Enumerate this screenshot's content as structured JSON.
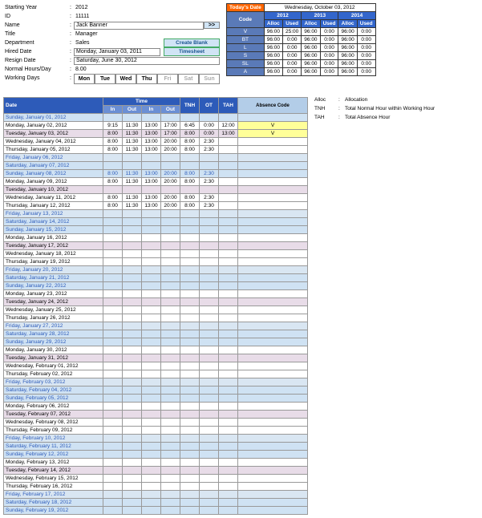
{
  "form": {
    "labels": {
      "year": "Starting Year",
      "id": "ID",
      "name": "Name",
      "title": "Title",
      "dept": "Department",
      "hired": "Hired Date",
      "resign": "Resign Date",
      "hours": "Normal Hours/Day",
      "days": "Working Days"
    },
    "values": {
      "year": "2012",
      "id": "11111",
      "name": "Jack Banner",
      "title": "Manager",
      "dept": "Sales",
      "hired": "Monday, January 03, 2011",
      "resign": "Saturday, June 30, 2012",
      "hours": "8.00"
    },
    "nav": ">>",
    "actions": {
      "blank": "Create Blank",
      "ts": "Timesheet"
    },
    "days": [
      "Mon",
      "Tue",
      "Wed",
      "Thu",
      "Fri",
      "Sat",
      "Sun"
    ]
  },
  "alloc": {
    "todayLabel": "Today's Date",
    "todayValue": "Wednesday, October 03, 2012",
    "codeHdr": "Code",
    "years": [
      "2012",
      "2013",
      "2014"
    ],
    "sub": [
      "Alloc",
      "Used"
    ],
    "rows": [
      {
        "c": "V",
        "v": [
          "96:00",
          "25:00",
          "96:00",
          "0:00",
          "96:00",
          "0:00"
        ]
      },
      {
        "c": "BT",
        "v": [
          "96:00",
          "0:00",
          "96:00",
          "0:00",
          "96:00",
          "0:00"
        ]
      },
      {
        "c": "L",
        "v": [
          "96:00",
          "0:00",
          "96:00",
          "0:00",
          "96:00",
          "0:00"
        ]
      },
      {
        "c": "S",
        "v": [
          "96:00",
          "0:00",
          "96:00",
          "0:00",
          "96:00",
          "0:00"
        ]
      },
      {
        "c": "SL",
        "v": [
          "96:00",
          "0:00",
          "96:00",
          "0:00",
          "96:00",
          "0:00"
        ]
      },
      {
        "c": "A",
        "v": [
          "96:00",
          "0:00",
          "96:00",
          "0:00",
          "96:00",
          "0:00"
        ]
      }
    ]
  },
  "legend": [
    [
      "Alloc",
      "Allocation"
    ],
    [
      "TNH",
      "Total Normal Hour within Working Hour"
    ],
    [
      "TAH",
      "Total Absence Hour"
    ]
  ],
  "table": {
    "hdr": {
      "date": "Date",
      "time": "Time",
      "tnh": "TNH",
      "ot": "OT",
      "tah": "TAH",
      "abs": "Absence Code",
      "in": "In",
      "out": "Out"
    },
    "rows": [
      {
        "d": "Sunday, January 01, 2012",
        "cls": "row-sun"
      },
      {
        "d": "Monday, January 02, 2012",
        "cls": "row-mon",
        "t": [
          "9:15",
          "11:30",
          "13:00",
          "17:00"
        ],
        "tnh": "6:45",
        "ot": "0:00",
        "tah": "12:00",
        "abs": "V"
      },
      {
        "d": "Tuesday, January 03, 2012",
        "cls": "row-tue",
        "t": [
          "8:00",
          "11:30",
          "13:00",
          "17:00"
        ],
        "tnh": "8:00",
        "ot": "0:00",
        "tah": "13:00",
        "abs": "V"
      },
      {
        "d": "Wednesday, January 04, 2012",
        "cls": "row-wed",
        "t": [
          "8:00",
          "11:30",
          "13:00",
          "20:00"
        ],
        "tnh": "8:00",
        "ot": "2:30"
      },
      {
        "d": "Thursday, January 05, 2012",
        "cls": "row-thu",
        "t": [
          "8:00",
          "11:30",
          "13:00",
          "20:00"
        ],
        "tnh": "8:00",
        "ot": "2:30"
      },
      {
        "d": "Friday, January 06, 2012",
        "cls": "row-fri"
      },
      {
        "d": "Saturday, January 07, 2012",
        "cls": "row-sat"
      },
      {
        "d": "Sunday, January 08, 2012",
        "cls": "row-sun",
        "t": [
          "8:00",
          "11:30",
          "13:00",
          "20:00"
        ],
        "tnh": "8:00",
        "ot": "2:30"
      },
      {
        "d": "Monday, January 09, 2012",
        "cls": "row-mon",
        "t": [
          "8:00",
          "11:30",
          "13:00",
          "20:00"
        ],
        "tnh": "8:00",
        "ot": "2:30"
      },
      {
        "d": "Tuesday, January 10, 2012",
        "cls": "row-tue"
      },
      {
        "d": "Wednesday, January 11, 2012",
        "cls": "row-wed",
        "t": [
          "8:00",
          "11:30",
          "13:00",
          "20:00"
        ],
        "tnh": "8:00",
        "ot": "2:30"
      },
      {
        "d": "Thursday, January 12, 2012",
        "cls": "row-thu",
        "t": [
          "8:00",
          "11:30",
          "13:00",
          "20:00"
        ],
        "tnh": "8:00",
        "ot": "2:30"
      },
      {
        "d": "Friday, January 13, 2012",
        "cls": "row-fri"
      },
      {
        "d": "Saturday, January 14, 2012",
        "cls": "row-sat"
      },
      {
        "d": "Sunday, January 15, 2012",
        "cls": "row-sun"
      },
      {
        "d": "Monday, January 16, 2012",
        "cls": "row-mon"
      },
      {
        "d": "Tuesday, January 17, 2012",
        "cls": "row-tue"
      },
      {
        "d": "Wednesday, January 18, 2012",
        "cls": "row-wed"
      },
      {
        "d": "Thursday, January 19, 2012",
        "cls": "row-thu"
      },
      {
        "d": "Friday, January 20, 2012",
        "cls": "row-fri"
      },
      {
        "d": "Saturday, January 21, 2012",
        "cls": "row-sat"
      },
      {
        "d": "Sunday, January 22, 2012",
        "cls": "row-sun"
      },
      {
        "d": "Monday, January 23, 2012",
        "cls": "row-mon"
      },
      {
        "d": "Tuesday, January 24, 2012",
        "cls": "row-tue"
      },
      {
        "d": "Wednesday, January 25, 2012",
        "cls": "row-wed"
      },
      {
        "d": "Thursday, January 26, 2012",
        "cls": "row-thu"
      },
      {
        "d": "Friday, January 27, 2012",
        "cls": "row-fri"
      },
      {
        "d": "Saturday, January 28, 2012",
        "cls": "row-sat"
      },
      {
        "d": "Sunday, January 29, 2012",
        "cls": "row-sun"
      },
      {
        "d": "Monday, January 30, 2012",
        "cls": "row-mon"
      },
      {
        "d": "Tuesday, January 31, 2012",
        "cls": "row-tue"
      },
      {
        "d": "Wednesday, February 01, 2012",
        "cls": "row-wed"
      },
      {
        "d": "Thursday, February 02, 2012",
        "cls": "row-thu"
      },
      {
        "d": "Friday, February 03, 2012",
        "cls": "row-fri"
      },
      {
        "d": "Saturday, February 04, 2012",
        "cls": "row-sat"
      },
      {
        "d": "Sunday, February 05, 2012",
        "cls": "row-sun"
      },
      {
        "d": "Monday, February 06, 2012",
        "cls": "row-mon"
      },
      {
        "d": "Tuesday, February 07, 2012",
        "cls": "row-tue"
      },
      {
        "d": "Wednesday, February 08, 2012",
        "cls": "row-wed"
      },
      {
        "d": "Thursday, February 09, 2012",
        "cls": "row-thu"
      },
      {
        "d": "Friday, February 10, 2012",
        "cls": "row-fri"
      },
      {
        "d": "Saturday, February 11, 2012",
        "cls": "row-sat"
      },
      {
        "d": "Sunday, February 12, 2012",
        "cls": "row-sun"
      },
      {
        "d": "Monday, February 13, 2012",
        "cls": "row-mon"
      },
      {
        "d": "Tuesday, February 14, 2012",
        "cls": "row-tue"
      },
      {
        "d": "Wednesday, February 15, 2012",
        "cls": "row-wed"
      },
      {
        "d": "Thursday, February 16, 2012",
        "cls": "row-thu"
      },
      {
        "d": "Friday, February 17, 2012",
        "cls": "row-fri"
      },
      {
        "d": "Saturday, February 18, 2012",
        "cls": "row-sat"
      },
      {
        "d": "Sunday, February 19, 2012",
        "cls": "row-sun"
      }
    ]
  }
}
